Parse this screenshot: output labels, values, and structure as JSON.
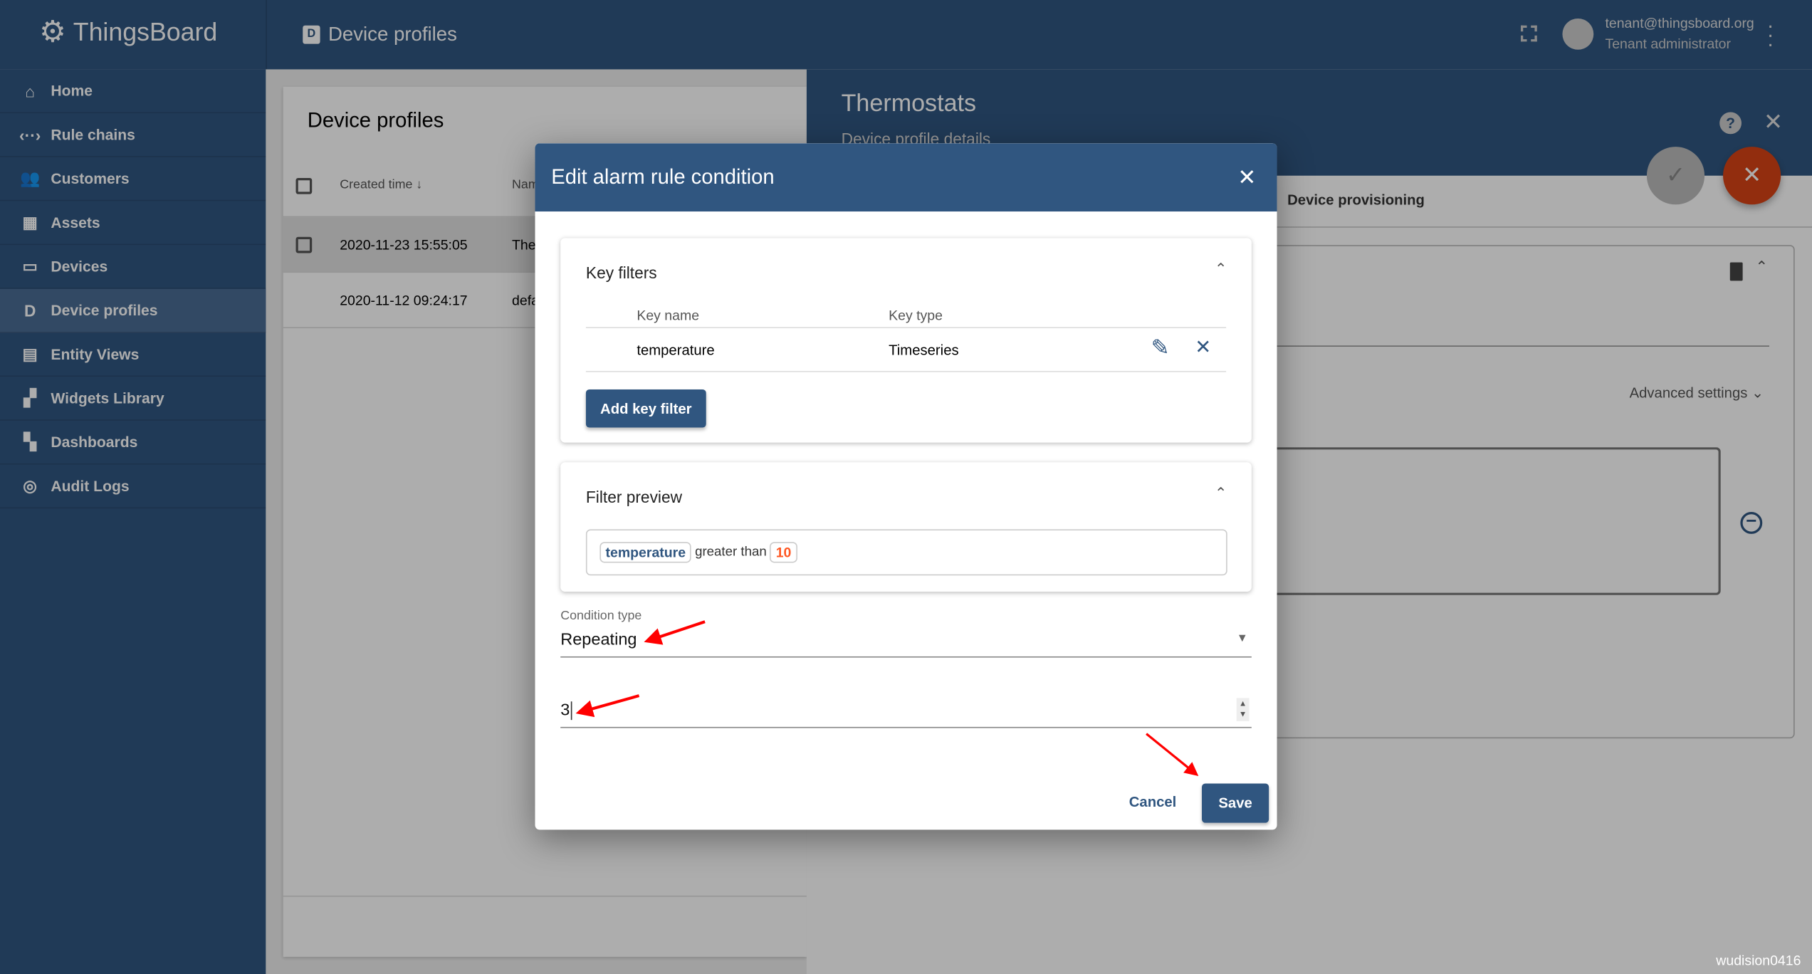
{
  "app": {
    "brand": "ThingsBoard",
    "page_title": "Device profiles",
    "user_email": "tenant@thingsboard.org",
    "user_role": "Tenant administrator"
  },
  "sidebar": {
    "items": [
      {
        "label": "Home",
        "icon": "home-icon",
        "glyph": "⌂"
      },
      {
        "label": "Rule chains",
        "icon": "rule-chains-icon",
        "glyph": "‹··›"
      },
      {
        "label": "Customers",
        "icon": "customers-icon",
        "glyph": "👥"
      },
      {
        "label": "Assets",
        "icon": "assets-icon",
        "glyph": "▦"
      },
      {
        "label": "Devices",
        "icon": "devices-icon",
        "glyph": "▭"
      },
      {
        "label": "Device profiles",
        "icon": "device-profile-icon",
        "glyph": "D",
        "selected": true
      },
      {
        "label": "Entity Views",
        "icon": "entity-views-icon",
        "glyph": "▤"
      },
      {
        "label": "Widgets Library",
        "icon": "widgets-icon",
        "glyph": "▞"
      },
      {
        "label": "Dashboards",
        "icon": "dashboards-icon",
        "glyph": "▚"
      },
      {
        "label": "Audit Logs",
        "icon": "audit-logs-icon",
        "glyph": "◎"
      }
    ]
  },
  "list": {
    "title": "Device profiles",
    "col_created": "Created time",
    "col_name": "Nam",
    "rows": [
      {
        "created": "2020-11-23 15:55:05",
        "name": "The"
      },
      {
        "created": "2020-11-12 09:24:17",
        "name": "defa"
      }
    ]
  },
  "details": {
    "title": "Thermostats",
    "subtitle": "Device profile details",
    "tab": "Device provisioning",
    "advanced": "Advanced settings"
  },
  "dialog": {
    "title": "Edit alarm rule condition",
    "key_filters": {
      "title": "Key filters",
      "col_key_name": "Key name",
      "col_key_type": "Key type",
      "rows": [
        {
          "key_name": "temperature",
          "key_type": "Timeseries"
        }
      ],
      "add_label": "Add key filter"
    },
    "filter_preview": {
      "title": "Filter preview",
      "key": "temperature",
      "operation": "greater than",
      "value": "10"
    },
    "condition_type": {
      "label": "Condition type",
      "value": "Repeating"
    },
    "count": {
      "value": "3"
    },
    "cancel_label": "Cancel",
    "save_label": "Save"
  },
  "watermark": "wudision0416",
  "colors": {
    "primary": "#305680",
    "accent": "#d84315",
    "value": "#ff5722",
    "annotation": "#ff0000"
  }
}
